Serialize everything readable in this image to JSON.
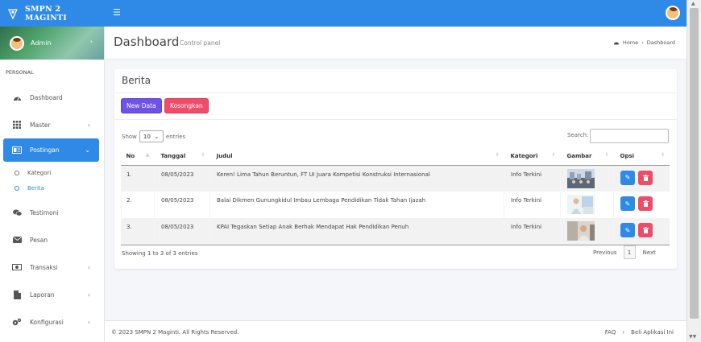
{
  "app": {
    "brand": "SMPN 2 MAGINTI",
    "colors": {
      "primary": "#2e8ae6",
      "new_button": "#6f52e8",
      "danger": "#ef4c6a"
    }
  },
  "user": {
    "name": "Admin"
  },
  "sidebar": {
    "section": "PERSONAL",
    "items": [
      {
        "label": "Dashboard",
        "icon": "dashboard-icon"
      },
      {
        "label": "Master",
        "icon": "grid-icon"
      },
      {
        "label": "Postingan",
        "icon": "postingan-icon",
        "sub": [
          "Kategori",
          "Berita"
        ]
      },
      {
        "label": "Testimoni",
        "icon": "chat-icon"
      },
      {
        "label": "Pesan",
        "icon": "envelope-icon"
      },
      {
        "label": "Transaksi",
        "icon": "money-icon"
      },
      {
        "label": "Laporan",
        "icon": "file-icon"
      },
      {
        "label": "Konfigurasi",
        "icon": "gears-icon"
      }
    ]
  },
  "header": {
    "title": "Dashboard",
    "subtitle": "Control panel",
    "breadcrumb": [
      "Home",
      "Dashboard"
    ]
  },
  "card": {
    "title": "Berita",
    "buttons": {
      "new": "New Data",
      "empty": "Kosongkan"
    },
    "show_prefix": "Show",
    "show_value": "10",
    "show_suffix": "entries",
    "search_label": "Search:",
    "columns": [
      "No",
      "Tanggal",
      "Judul",
      "Kategori",
      "Gambar",
      "Opsi"
    ],
    "rows": [
      {
        "no": "1.",
        "tanggal": "08/05/2023",
        "judul": "Keren! Lima Tahun Beruntun, FT UI Juara Kompetisi Konstruksi Internasional",
        "kategori": "Info Terkini"
      },
      {
        "no": "2.",
        "tanggal": "08/05/2023",
        "judul": "Balai Dikmen Gunungkidul Imbau Lembaga Pendidikan Tidak Tahan Ijazah",
        "kategori": "Info Terkini"
      },
      {
        "no": "3.",
        "tanggal": "08/05/2023",
        "judul": "KPAI Tegaskan Setiap Anak Berhak Mendapat Hak Pendidikan Penuh",
        "kategori": "Info Terkini"
      }
    ],
    "info": "Showing 1 to 3 of 3 entries",
    "pagination": {
      "prev": "Previous",
      "page": "1",
      "next": "Next"
    }
  },
  "footer": {
    "copyright": "© 2023 SMPN 2 Maginti. All Rights Reserved.",
    "links": [
      "FAQ",
      "Beli Aplikasi Ini"
    ]
  }
}
